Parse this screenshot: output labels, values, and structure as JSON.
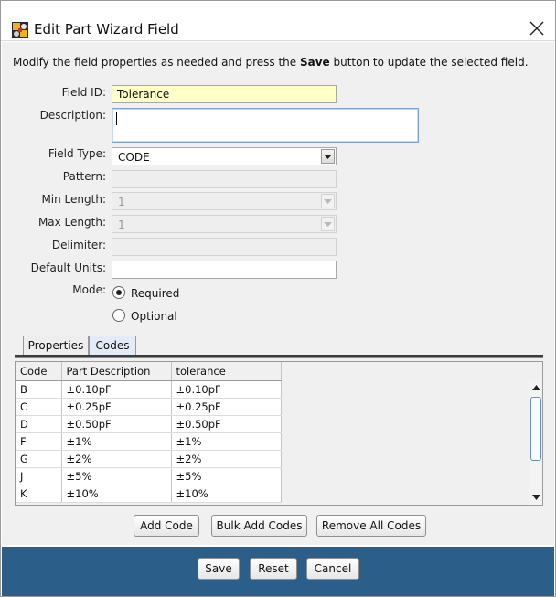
{
  "window": {
    "title": "Edit Part Wizard Field"
  },
  "intro": {
    "before": "Modify the field properties as needed and press the ",
    "bold": "Save",
    "after": " button to update the selected field."
  },
  "form": {
    "field_id": {
      "label": "Field ID:",
      "value": "Tolerance"
    },
    "description": {
      "label": "Description:",
      "value": ""
    },
    "field_type": {
      "label": "Field Type:",
      "value": "CODE"
    },
    "pattern": {
      "label": "Pattern:",
      "value": ""
    },
    "min_length": {
      "label": "Min Length:",
      "value": "1"
    },
    "max_length": {
      "label": "Max Length:",
      "value": "1"
    },
    "delimiter": {
      "label": "Delimiter:",
      "value": ""
    },
    "default_units": {
      "label": "Default Units:",
      "value": ""
    },
    "mode": {
      "label": "Mode:",
      "options": [
        "Required",
        "Optional"
      ],
      "selected": "Required"
    }
  },
  "tabs": [
    {
      "label": "Properties"
    },
    {
      "label": "Codes",
      "active": true
    }
  ],
  "codes_table": {
    "headers": [
      "Code",
      "Part Description",
      "tolerance"
    ],
    "rows": [
      [
        "B",
        "±0.10pF",
        "±0.10pF"
      ],
      [
        "C",
        "±0.25pF",
        "±0.25pF"
      ],
      [
        "D",
        "±0.50pF",
        "±0.50pF"
      ],
      [
        "F",
        "±1%",
        "±1%"
      ],
      [
        "G",
        "±2%",
        "±2%"
      ],
      [
        "J",
        "±5%",
        "±5%"
      ],
      [
        "K",
        "±10%",
        "±10%"
      ]
    ]
  },
  "code_buttons": {
    "add": "Add Code",
    "bulk_add": "Bulk Add Codes",
    "remove_all": "Remove All Codes"
  },
  "footer_buttons": {
    "save": "Save",
    "reset": "Reset",
    "cancel": "Cancel"
  },
  "colors": {
    "footer": "#2b5e89",
    "field_highlight": "#ffffc8",
    "focus_border": "#7da2ce"
  },
  "icons": {
    "app": "app-logo-icon",
    "close": "close-icon",
    "dropdown": "chevron-down-icon"
  }
}
